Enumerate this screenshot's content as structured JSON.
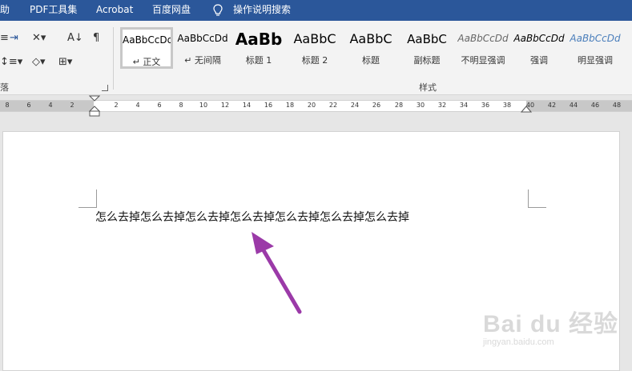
{
  "menu": {
    "items": [
      "助",
      "PDF工具集",
      "Acrobat",
      "百度网盘",
      "操作说明搜索"
    ]
  },
  "ribbon": {
    "paragraph_group_label": "落",
    "styles_group_label": "样式",
    "styles": [
      {
        "sample": "AaBbCcDd",
        "name": "↵ 正文",
        "selected": true
      },
      {
        "sample": "AaBbCcDd",
        "name": "↵ 无间隔",
        "selected": false
      },
      {
        "sample": "AaBb",
        "name": "标题 1",
        "selected": false
      },
      {
        "sample": "AaBbC",
        "name": "标题 2",
        "selected": false
      },
      {
        "sample": "AaBbC",
        "name": "标题",
        "selected": false
      },
      {
        "sample": "AaBbC",
        "name": "副标题",
        "selected": false
      },
      {
        "sample": "AaBbCcDd",
        "name": "不明显强调",
        "selected": false
      },
      {
        "sample": "AaBbCcDd",
        "name": "强调",
        "selected": false
      },
      {
        "sample": "AaBbCcDd",
        "name": "明显强调",
        "selected": false
      }
    ]
  },
  "ruler": {
    "ticks": [
      "8",
      "6",
      "4",
      "2",
      "2",
      "4",
      "6",
      "8",
      "10",
      "12",
      "14",
      "16",
      "18",
      "20",
      "22",
      "24",
      "26",
      "28",
      "30",
      "32",
      "34",
      "36",
      "38",
      "40",
      "42",
      "44",
      "46",
      "48"
    ]
  },
  "document": {
    "body_text": "怎么去掉怎么去掉怎么去掉怎么去掉怎么去掉怎么去掉怎么去掉"
  },
  "watermark": {
    "brand": "Bai du 经验",
    "url": "jingyan.baidu.com"
  },
  "colors": {
    "title_bar": "#2b579a",
    "arrow": "#9b3aa8"
  }
}
